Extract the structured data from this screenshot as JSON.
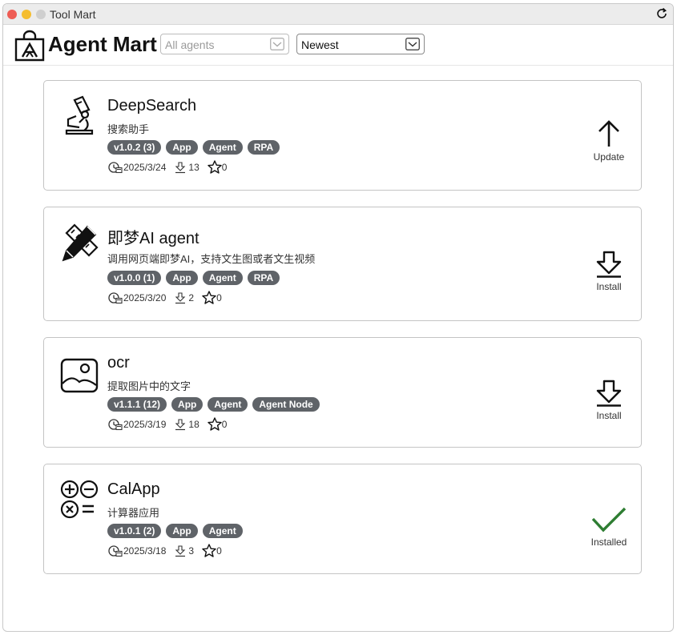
{
  "window": {
    "title": "Tool Mart"
  },
  "header": {
    "app_name": "Agent Mart",
    "filter": {
      "value": "All agents"
    },
    "sort": {
      "value": "Newest"
    }
  },
  "agents": [
    {
      "name": "DeepSearch",
      "description": "搜索助手",
      "tags": [
        "v1.0.2 (3)",
        "App",
        "Agent",
        "RPA"
      ],
      "date": "2025/3/24",
      "downloads": "13",
      "stars": "0",
      "icon": "microscope-icon",
      "action": {
        "label": "Update",
        "icon": "arrow-up-icon"
      }
    },
    {
      "name": "即梦AI agent",
      "description": "调用网页端即梦AI，支持文生图或者文生视频",
      "tags": [
        "v1.0.0 (1)",
        "App",
        "Agent",
        "RPA"
      ],
      "date": "2025/3/20",
      "downloads": "2",
      "stars": "0",
      "icon": "pencil-ruler-icon",
      "action": {
        "label": "Install",
        "icon": "download-icon"
      }
    },
    {
      "name": "ocr",
      "description": "提取图片中的文字",
      "tags": [
        "v1.1.1 (12)",
        "App",
        "Agent",
        "Agent Node"
      ],
      "date": "2025/3/19",
      "downloads": "18",
      "stars": "0",
      "icon": "image-icon",
      "action": {
        "label": "Install",
        "icon": "download-icon"
      }
    },
    {
      "name": "CalApp",
      "description": "计算器应用",
      "tags": [
        "v1.0.1 (2)",
        "App",
        "Agent"
      ],
      "date": "2025/3/18",
      "downloads": "3",
      "stars": "0",
      "icon": "calculator-icon",
      "action": {
        "label": "Installed",
        "icon": "checkmark-icon"
      }
    }
  ],
  "colors": {
    "tag_bg": "#5f6368",
    "installed_check": "#2e7d32",
    "close": "#ee5c54",
    "minimize": "#f5bd2f"
  }
}
